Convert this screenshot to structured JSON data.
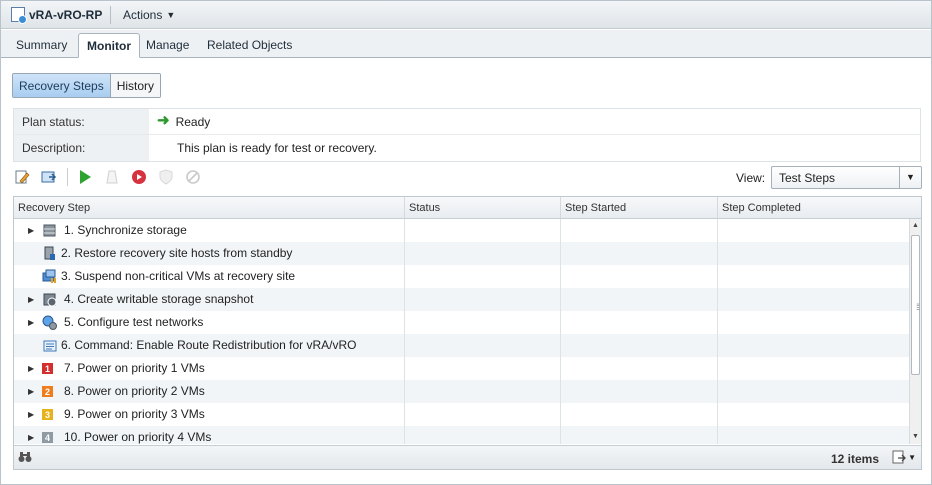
{
  "title": {
    "object": "vRA-vRO-RP",
    "actions": "Actions"
  },
  "tabs": [
    "Summary",
    "Monitor",
    "Manage",
    "Related Objects"
  ],
  "subtabs": [
    "Recovery Steps",
    "History"
  ],
  "plan": {
    "status_label": "Plan status:",
    "status_value": "Ready",
    "description_label": "Description:",
    "description_value": "This plan is ready for test or recovery."
  },
  "view": {
    "label": "View:",
    "value": "Test Steps"
  },
  "columns": [
    "Recovery Step",
    "Status",
    "Step Started",
    "Step Completed"
  ],
  "steps": [
    {
      "label": "1. Synchronize storage",
      "expandable": true,
      "icon": "storage-icon"
    },
    {
      "label": "2. Restore recovery site hosts from standby",
      "expandable": false,
      "icon": "host-icon"
    },
    {
      "label": "3. Suspend non-critical VMs at recovery site",
      "expandable": false,
      "icon": "vms-pause-icon"
    },
    {
      "label": "4. Create writable storage snapshot",
      "expandable": true,
      "icon": "snapshot-icon"
    },
    {
      "label": "5. Configure test networks",
      "expandable": true,
      "icon": "network-icon"
    },
    {
      "label": "6. Command: Enable Route Redistribution for vRA/vRO",
      "expandable": false,
      "icon": "command-icon"
    },
    {
      "label": "7. Power on priority 1 VMs",
      "expandable": true,
      "icon": "priority-1-icon",
      "badge": "1",
      "color": "#d32f2f"
    },
    {
      "label": "8. Power on priority 2 VMs",
      "expandable": true,
      "icon": "priority-2-icon",
      "badge": "2",
      "color": "#ef7d1e"
    },
    {
      "label": "9. Power on priority 3 VMs",
      "expandable": true,
      "icon": "priority-3-icon",
      "badge": "3",
      "color": "#e8b21c"
    },
    {
      "label": "10. Power on priority 4 VMs",
      "expandable": true,
      "icon": "priority-4-icon",
      "badge": "4",
      "color": "#8f9aa3"
    }
  ],
  "footer": {
    "count": "12 items"
  }
}
